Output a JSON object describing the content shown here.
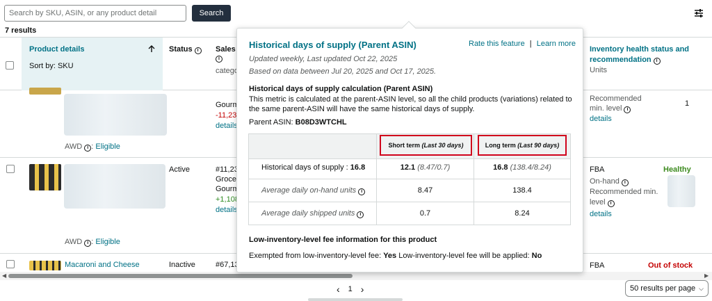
{
  "toolbar": {
    "search_placeholder": "Search by SKU, ASIN, or any product detail",
    "search_button": "Search",
    "results_count": "7 results"
  },
  "table": {
    "headers": {
      "product_details": "Product details",
      "sort_by": "Sort by: SKU",
      "status": "Status",
      "sales_rank": "Sales r",
      "sales_rank_sub": "catego",
      "inventory_health": "Inventory health status and",
      "inventory_health_2": "recommendation",
      "inventory_units": "Units"
    },
    "rows": [
      {
        "sales_cat": "Gourm",
        "sales_delta": "-11,23",
        "details": "details",
        "awd_label": "AWD",
        "awd_status": "Eligible",
        "health_line1": "Recommended",
        "health_line2": "min. level",
        "health_details": "details",
        "health_value": "1"
      },
      {
        "status": "Active",
        "sales_rank": "#11,23",
        "sales_cat1": "Grocer",
        "sales_cat2": "Gourm",
        "sales_delta": "+1,108",
        "details": "details",
        "awd_label": "AWD",
        "awd_status": "Eligible",
        "channel": "FBA",
        "health": "Healthy",
        "onhand": "On-hand",
        "rec_min": "Recommended min.",
        "level": "level",
        "health_details": "details"
      },
      {
        "product_name": "Macaroni and Cheese",
        "status": "Inactive",
        "sales_rank": "#67,13",
        "channel": "FBA",
        "health": "Out of stock"
      }
    ]
  },
  "popover": {
    "title": "Historical days of supply (Parent ASIN)",
    "rate_link": "Rate this feature",
    "separator": "|",
    "learn_link": "Learn more",
    "updated": "Updated weekly, Last updated Oct 22, 2025",
    "based_on": "Based on data between Jul 20, 2025 and Oct 17, 2025.",
    "calc_heading": "Historical days of supply calculation (Parent ASIN)",
    "calc_text_1": "This metric is calculated at the parent-ASIN level, so all the child products (variations) related to",
    "calc_text_2": "the same parent-ASIN will have the same historical days of supply.",
    "parent_asin_label": "Parent ASIN:",
    "parent_asin": "B08D3WTCHL",
    "col_short": "Short term",
    "col_short_period": "(Last 30 days)",
    "col_long": "Long term",
    "col_long_period": "(Last 90 days)",
    "row1_label": "Historical days of supply :",
    "row1_value": "16.8",
    "row1_short": "12.1",
    "row1_short_detail": "(8.47/0.7)",
    "row1_long": "16.8",
    "row1_long_detail": "(138.4/8.24)",
    "row2_label": "Average daily on-hand units",
    "row2_short": "8.47",
    "row2_long": "138.4",
    "row3_label": "Average daily shipped units",
    "row3_short": "0.7",
    "row3_long": "8.24",
    "fee_heading": "Low-inventory-level fee information for this product",
    "exempt_label": "Exempted from low-inventory-level fee:",
    "exempt_value": "Yes",
    "applied_label": "Low-inventory-level fee will be applied:",
    "applied_value": "No"
  },
  "pagination": {
    "prev": "‹",
    "page": "1",
    "next": "›",
    "per_page": "50 results per page"
  },
  "icons": {
    "settings": "sliders-icon",
    "sort": "arrow-up-icon",
    "info": "info-icon"
  },
  "colors": {
    "link": "#007185",
    "search_button": "#232f3e",
    "healthy": "#3c8a1e",
    "out_of_stock": "#c40000",
    "highlight_box": "#d0021b"
  }
}
